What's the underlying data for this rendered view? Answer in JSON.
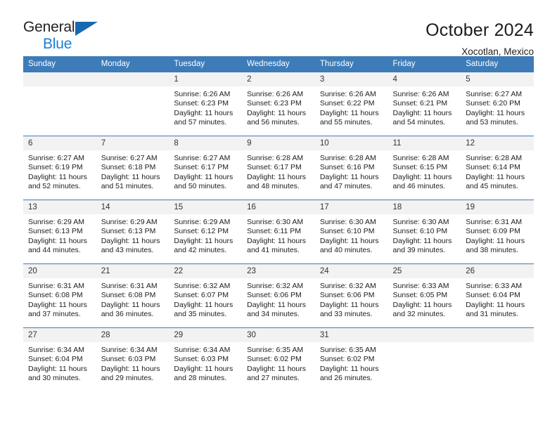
{
  "logo": {
    "word_top": "General",
    "word_bottom": "Blue",
    "triangle_color": "#1769b0"
  },
  "header": {
    "title": "October 2024",
    "subtitle": "Xocotlan, Mexico"
  },
  "theme": {
    "header_blue": "#3d7cb8",
    "daynum_bg": "#f2f2f2",
    "logo_blue": "#1a7fd4"
  },
  "weekdays": [
    "Sunday",
    "Monday",
    "Tuesday",
    "Wednesday",
    "Thursday",
    "Friday",
    "Saturday"
  ],
  "labels": {
    "sunrise": "Sunrise:",
    "sunset": "Sunset:",
    "daylight": "Daylight:"
  },
  "weeks": [
    [
      {
        "day": ""
      },
      {
        "day": ""
      },
      {
        "day": "1",
        "sunrise": "Sunrise: 6:26 AM",
        "sunset": "Sunset: 6:23 PM",
        "daylight": "Daylight: 11 hours and 57 minutes."
      },
      {
        "day": "2",
        "sunrise": "Sunrise: 6:26 AM",
        "sunset": "Sunset: 6:23 PM",
        "daylight": "Daylight: 11 hours and 56 minutes."
      },
      {
        "day": "3",
        "sunrise": "Sunrise: 6:26 AM",
        "sunset": "Sunset: 6:22 PM",
        "daylight": "Daylight: 11 hours and 55 minutes."
      },
      {
        "day": "4",
        "sunrise": "Sunrise: 6:26 AM",
        "sunset": "Sunset: 6:21 PM",
        "daylight": "Daylight: 11 hours and 54 minutes."
      },
      {
        "day": "5",
        "sunrise": "Sunrise: 6:27 AM",
        "sunset": "Sunset: 6:20 PM",
        "daylight": "Daylight: 11 hours and 53 minutes."
      }
    ],
    [
      {
        "day": "6",
        "sunrise": "Sunrise: 6:27 AM",
        "sunset": "Sunset: 6:19 PM",
        "daylight": "Daylight: 11 hours and 52 minutes."
      },
      {
        "day": "7",
        "sunrise": "Sunrise: 6:27 AM",
        "sunset": "Sunset: 6:18 PM",
        "daylight": "Daylight: 11 hours and 51 minutes."
      },
      {
        "day": "8",
        "sunrise": "Sunrise: 6:27 AM",
        "sunset": "Sunset: 6:17 PM",
        "daylight": "Daylight: 11 hours and 50 minutes."
      },
      {
        "day": "9",
        "sunrise": "Sunrise: 6:28 AM",
        "sunset": "Sunset: 6:17 PM",
        "daylight": "Daylight: 11 hours and 48 minutes."
      },
      {
        "day": "10",
        "sunrise": "Sunrise: 6:28 AM",
        "sunset": "Sunset: 6:16 PM",
        "daylight": "Daylight: 11 hours and 47 minutes."
      },
      {
        "day": "11",
        "sunrise": "Sunrise: 6:28 AM",
        "sunset": "Sunset: 6:15 PM",
        "daylight": "Daylight: 11 hours and 46 minutes."
      },
      {
        "day": "12",
        "sunrise": "Sunrise: 6:28 AM",
        "sunset": "Sunset: 6:14 PM",
        "daylight": "Daylight: 11 hours and 45 minutes."
      }
    ],
    [
      {
        "day": "13",
        "sunrise": "Sunrise: 6:29 AM",
        "sunset": "Sunset: 6:13 PM",
        "daylight": "Daylight: 11 hours and 44 minutes."
      },
      {
        "day": "14",
        "sunrise": "Sunrise: 6:29 AM",
        "sunset": "Sunset: 6:13 PM",
        "daylight": "Daylight: 11 hours and 43 minutes."
      },
      {
        "day": "15",
        "sunrise": "Sunrise: 6:29 AM",
        "sunset": "Sunset: 6:12 PM",
        "daylight": "Daylight: 11 hours and 42 minutes."
      },
      {
        "day": "16",
        "sunrise": "Sunrise: 6:30 AM",
        "sunset": "Sunset: 6:11 PM",
        "daylight": "Daylight: 11 hours and 41 minutes."
      },
      {
        "day": "17",
        "sunrise": "Sunrise: 6:30 AM",
        "sunset": "Sunset: 6:10 PM",
        "daylight": "Daylight: 11 hours and 40 minutes."
      },
      {
        "day": "18",
        "sunrise": "Sunrise: 6:30 AM",
        "sunset": "Sunset: 6:10 PM",
        "daylight": "Daylight: 11 hours and 39 minutes."
      },
      {
        "day": "19",
        "sunrise": "Sunrise: 6:31 AM",
        "sunset": "Sunset: 6:09 PM",
        "daylight": "Daylight: 11 hours and 38 minutes."
      }
    ],
    [
      {
        "day": "20",
        "sunrise": "Sunrise: 6:31 AM",
        "sunset": "Sunset: 6:08 PM",
        "daylight": "Daylight: 11 hours and 37 minutes."
      },
      {
        "day": "21",
        "sunrise": "Sunrise: 6:31 AM",
        "sunset": "Sunset: 6:08 PM",
        "daylight": "Daylight: 11 hours and 36 minutes."
      },
      {
        "day": "22",
        "sunrise": "Sunrise: 6:32 AM",
        "sunset": "Sunset: 6:07 PM",
        "daylight": "Daylight: 11 hours and 35 minutes."
      },
      {
        "day": "23",
        "sunrise": "Sunrise: 6:32 AM",
        "sunset": "Sunset: 6:06 PM",
        "daylight": "Daylight: 11 hours and 34 minutes."
      },
      {
        "day": "24",
        "sunrise": "Sunrise: 6:32 AM",
        "sunset": "Sunset: 6:06 PM",
        "daylight": "Daylight: 11 hours and 33 minutes."
      },
      {
        "day": "25",
        "sunrise": "Sunrise: 6:33 AM",
        "sunset": "Sunset: 6:05 PM",
        "daylight": "Daylight: 11 hours and 32 minutes."
      },
      {
        "day": "26",
        "sunrise": "Sunrise: 6:33 AM",
        "sunset": "Sunset: 6:04 PM",
        "daylight": "Daylight: 11 hours and 31 minutes."
      }
    ],
    [
      {
        "day": "27",
        "sunrise": "Sunrise: 6:34 AM",
        "sunset": "Sunset: 6:04 PM",
        "daylight": "Daylight: 11 hours and 30 minutes."
      },
      {
        "day": "28",
        "sunrise": "Sunrise: 6:34 AM",
        "sunset": "Sunset: 6:03 PM",
        "daylight": "Daylight: 11 hours and 29 minutes."
      },
      {
        "day": "29",
        "sunrise": "Sunrise: 6:34 AM",
        "sunset": "Sunset: 6:03 PM",
        "daylight": "Daylight: 11 hours and 28 minutes."
      },
      {
        "day": "30",
        "sunrise": "Sunrise: 6:35 AM",
        "sunset": "Sunset: 6:02 PM",
        "daylight": "Daylight: 11 hours and 27 minutes."
      },
      {
        "day": "31",
        "sunrise": "Sunrise: 6:35 AM",
        "sunset": "Sunset: 6:02 PM",
        "daylight": "Daylight: 11 hours and 26 minutes."
      },
      {
        "day": ""
      },
      {
        "day": ""
      }
    ]
  ]
}
